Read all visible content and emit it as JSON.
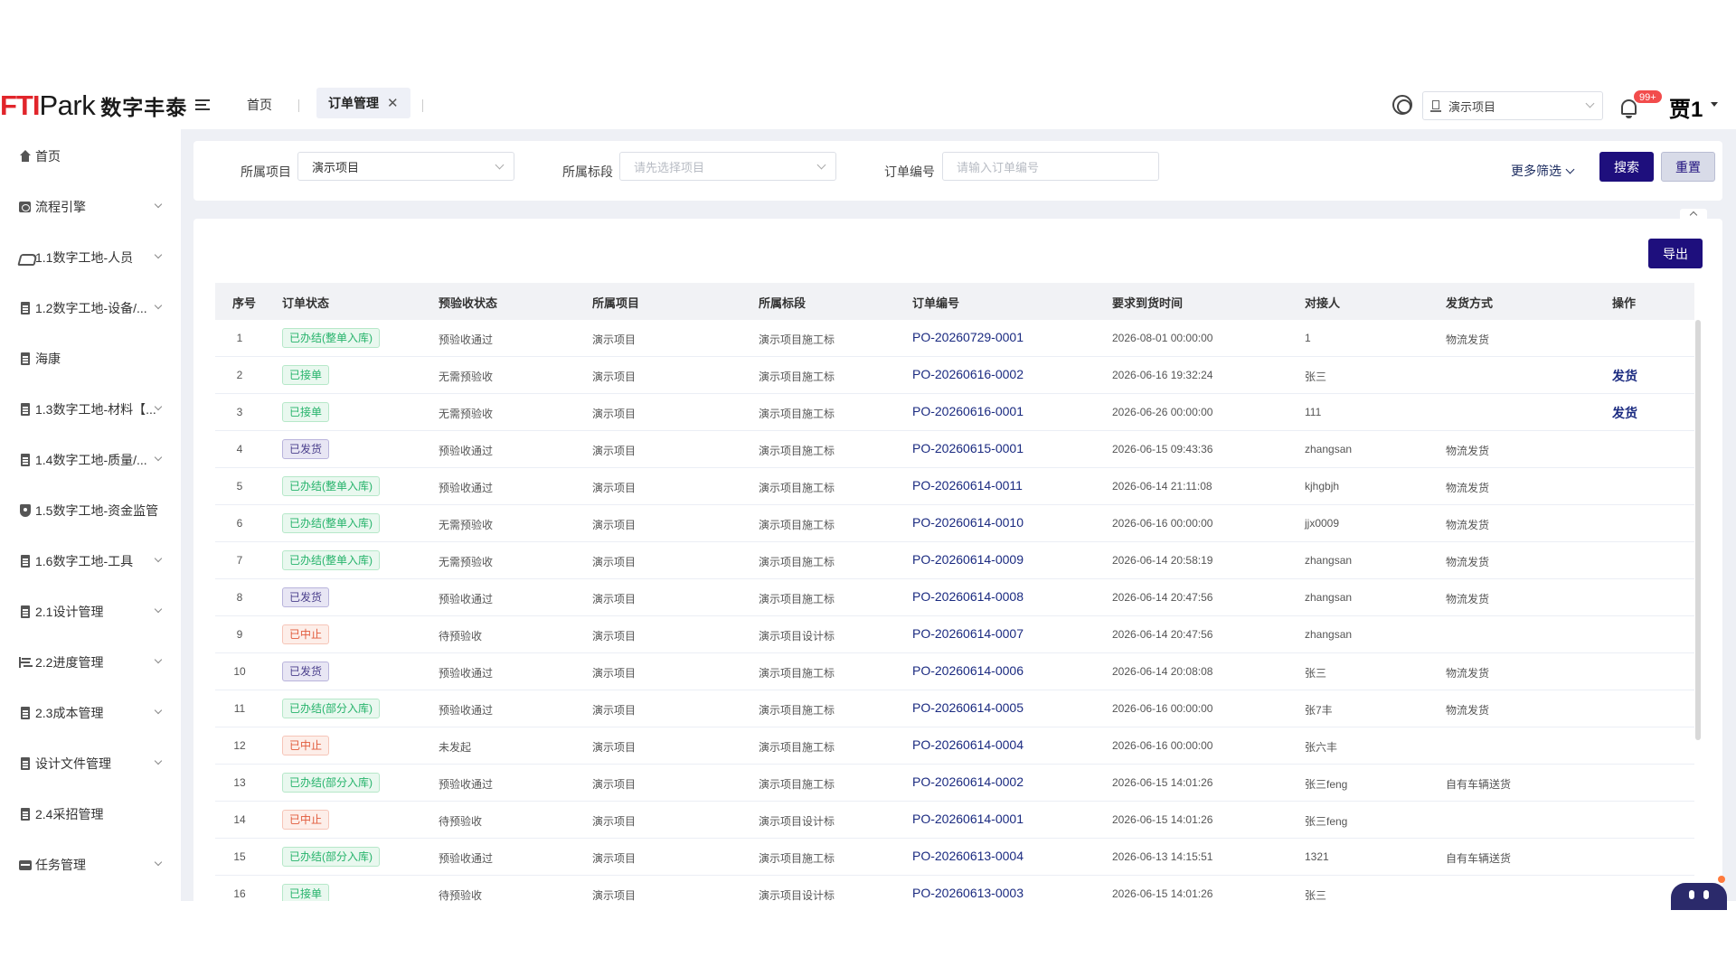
{
  "header": {
    "logo_mark": "FTIPark",
    "logo_text": "数字丰泰",
    "tabs": [
      {
        "label": "首页"
      },
      {
        "label": "订单管理"
      }
    ],
    "project_select": "演示项目",
    "notification_count": "99+",
    "user_name": "贾1"
  },
  "sidebar": {
    "items": [
      {
        "label": "首页",
        "icon": "home-icon"
      },
      {
        "label": "流程引擎",
        "icon": "flow-icon"
      },
      {
        "label": "1.1数字工地-人员",
        "icon": "handshake-icon"
      },
      {
        "label": "1.2数字工地-设备/...",
        "icon": "document-icon"
      },
      {
        "label": "海康",
        "icon": "document-icon"
      },
      {
        "label": "1.3数字工地-材料【...",
        "icon": "document-icon"
      },
      {
        "label": "1.4数字工地-质量/...",
        "icon": "document-icon"
      },
      {
        "label": "1.5数字工地-资金监管",
        "icon": "shield-icon"
      },
      {
        "label": "1.6数字工地-工具",
        "icon": "document-icon"
      },
      {
        "label": "2.1设计管理",
        "icon": "document-icon"
      },
      {
        "label": "2.2进度管理",
        "icon": "gantt-icon"
      },
      {
        "label": "2.3成本管理",
        "icon": "document-icon"
      },
      {
        "label": "设计文件管理",
        "icon": "document-icon"
      },
      {
        "label": "2.4采招管理",
        "icon": "document-icon"
      },
      {
        "label": "任务管理",
        "icon": "task-icon"
      }
    ]
  },
  "filters": {
    "project_label": "所属项目",
    "project_value": "演示项目",
    "section_label": "所属标段",
    "section_placeholder": "请先选择项目",
    "order_label": "订单编号",
    "order_placeholder": "请输入订单编号",
    "more_label": "更多筛选",
    "search_label": "搜索",
    "reset_label": "重置"
  },
  "table": {
    "export_label": "导出",
    "columns": [
      "序号",
      "订单状态",
      "预验收状态",
      "所属项目",
      "所属标段",
      "订单编号",
      "要求到货时间",
      "对接人",
      "发货方式",
      "操作"
    ],
    "rows": [
      {
        "idx": "1",
        "status": "已办结(整单入库)",
        "pre": "预验收通过",
        "project": "演示项目",
        "section": "演示项目施工标",
        "po": "PO-20260729-0001",
        "time": "2026-08-01 00:00:00",
        "contact": "1",
        "ship": "物流发货",
        "action": ""
      },
      {
        "idx": "2",
        "status": "已接单",
        "pre": "无需预验收",
        "project": "演示项目",
        "section": "演示项目施工标",
        "po": "PO-20260616-0002",
        "time": "2026-06-16 19:32:24",
        "contact": "张三",
        "ship": "",
        "action": "发货"
      },
      {
        "idx": "3",
        "status": "已接单",
        "pre": "无需预验收",
        "project": "演示项目",
        "section": "演示项目施工标",
        "po": "PO-20260616-0001",
        "time": "2026-06-26 00:00:00",
        "contact": "111",
        "ship": "",
        "action": "发货"
      },
      {
        "idx": "4",
        "status": "已发货",
        "pre": "预验收通过",
        "project": "演示项目",
        "section": "演示项目施工标",
        "po": "PO-20260615-0001",
        "time": "2026-06-15 09:43:36",
        "contact": "zhangsan",
        "ship": "物流发货",
        "action": ""
      },
      {
        "idx": "5",
        "status": "已办结(整单入库)",
        "pre": "预验收通过",
        "project": "演示项目",
        "section": "演示项目施工标",
        "po": "PO-20260614-0011",
        "time": "2026-06-14 21:11:08",
        "contact": "kjhgbjh",
        "ship": "物流发货",
        "action": ""
      },
      {
        "idx": "6",
        "status": "已办结(整单入库)",
        "pre": "无需预验收",
        "project": "演示项目",
        "section": "演示项目施工标",
        "po": "PO-20260614-0010",
        "time": "2026-06-16 00:00:00",
        "contact": "jjx0009",
        "ship": "物流发货",
        "action": ""
      },
      {
        "idx": "7",
        "status": "已办结(整单入库)",
        "pre": "无需预验收",
        "project": "演示项目",
        "section": "演示项目施工标",
        "po": "PO-20260614-0009",
        "time": "2026-06-14 20:58:19",
        "contact": "zhangsan",
        "ship": "物流发货",
        "action": ""
      },
      {
        "idx": "8",
        "status": "已发货",
        "pre": "预验收通过",
        "project": "演示项目",
        "section": "演示项目施工标",
        "po": "PO-20260614-0008",
        "time": "2026-06-14 20:47:56",
        "contact": "zhangsan",
        "ship": "物流发货",
        "action": ""
      },
      {
        "idx": "9",
        "status": "已中止",
        "pre": "待预验收",
        "project": "演示项目",
        "section": "演示项目设计标",
        "po": "PO-20260614-0007",
        "time": "2026-06-14 20:47:56",
        "contact": "zhangsan",
        "ship": "",
        "action": ""
      },
      {
        "idx": "10",
        "status": "已发货",
        "pre": "预验收通过",
        "project": "演示项目",
        "section": "演示项目施工标",
        "po": "PO-20260614-0006",
        "time": "2026-06-14 20:08:08",
        "contact": "张三",
        "ship": "物流发货",
        "action": ""
      },
      {
        "idx": "11",
        "status": "已办结(部分入库)",
        "pre": "预验收通过",
        "project": "演示项目",
        "section": "演示项目施工标",
        "po": "PO-20260614-0005",
        "time": "2026-06-16 00:00:00",
        "contact": "张7丰",
        "ship": "物流发货",
        "action": ""
      },
      {
        "idx": "12",
        "status": "已中止",
        "pre": "未发起",
        "project": "演示项目",
        "section": "演示项目施工标",
        "po": "PO-20260614-0004",
        "time": "2026-06-16 00:00:00",
        "contact": "张六丰",
        "ship": "",
        "action": ""
      },
      {
        "idx": "13",
        "status": "已办结(部分入库)",
        "pre": "预验收通过",
        "project": "演示项目",
        "section": "演示项目施工标",
        "po": "PO-20260614-0002",
        "time": "2026-06-15 14:01:26",
        "contact": "张三feng",
        "ship": "自有车辆送货",
        "action": ""
      },
      {
        "idx": "14",
        "status": "已中止",
        "pre": "待预验收",
        "project": "演示项目",
        "section": "演示项目设计标",
        "po": "PO-20260614-0001",
        "time": "2026-06-15 14:01:26",
        "contact": "张三feng",
        "ship": "",
        "action": ""
      },
      {
        "idx": "15",
        "status": "已办结(部分入库)",
        "pre": "预验收通过",
        "project": "演示项目",
        "section": "演示项目施工标",
        "po": "PO-20260613-0004",
        "time": "2026-06-13 14:15:51",
        "contact": "1321",
        "ship": "自有车辆送货",
        "action": ""
      },
      {
        "idx": "16",
        "status": "已接单",
        "pre": "待预验收",
        "project": "演示项目",
        "section": "演示项目设计标",
        "po": "PO-20260613-0003",
        "time": "2026-06-15 14:01:26",
        "contact": "张三",
        "ship": "",
        "action": ""
      }
    ]
  },
  "status_colors": {
    "green": "#26b36b",
    "purple": "#4a3f8c",
    "red": "#e15b3c"
  },
  "accent_color": "#1e0f7d"
}
